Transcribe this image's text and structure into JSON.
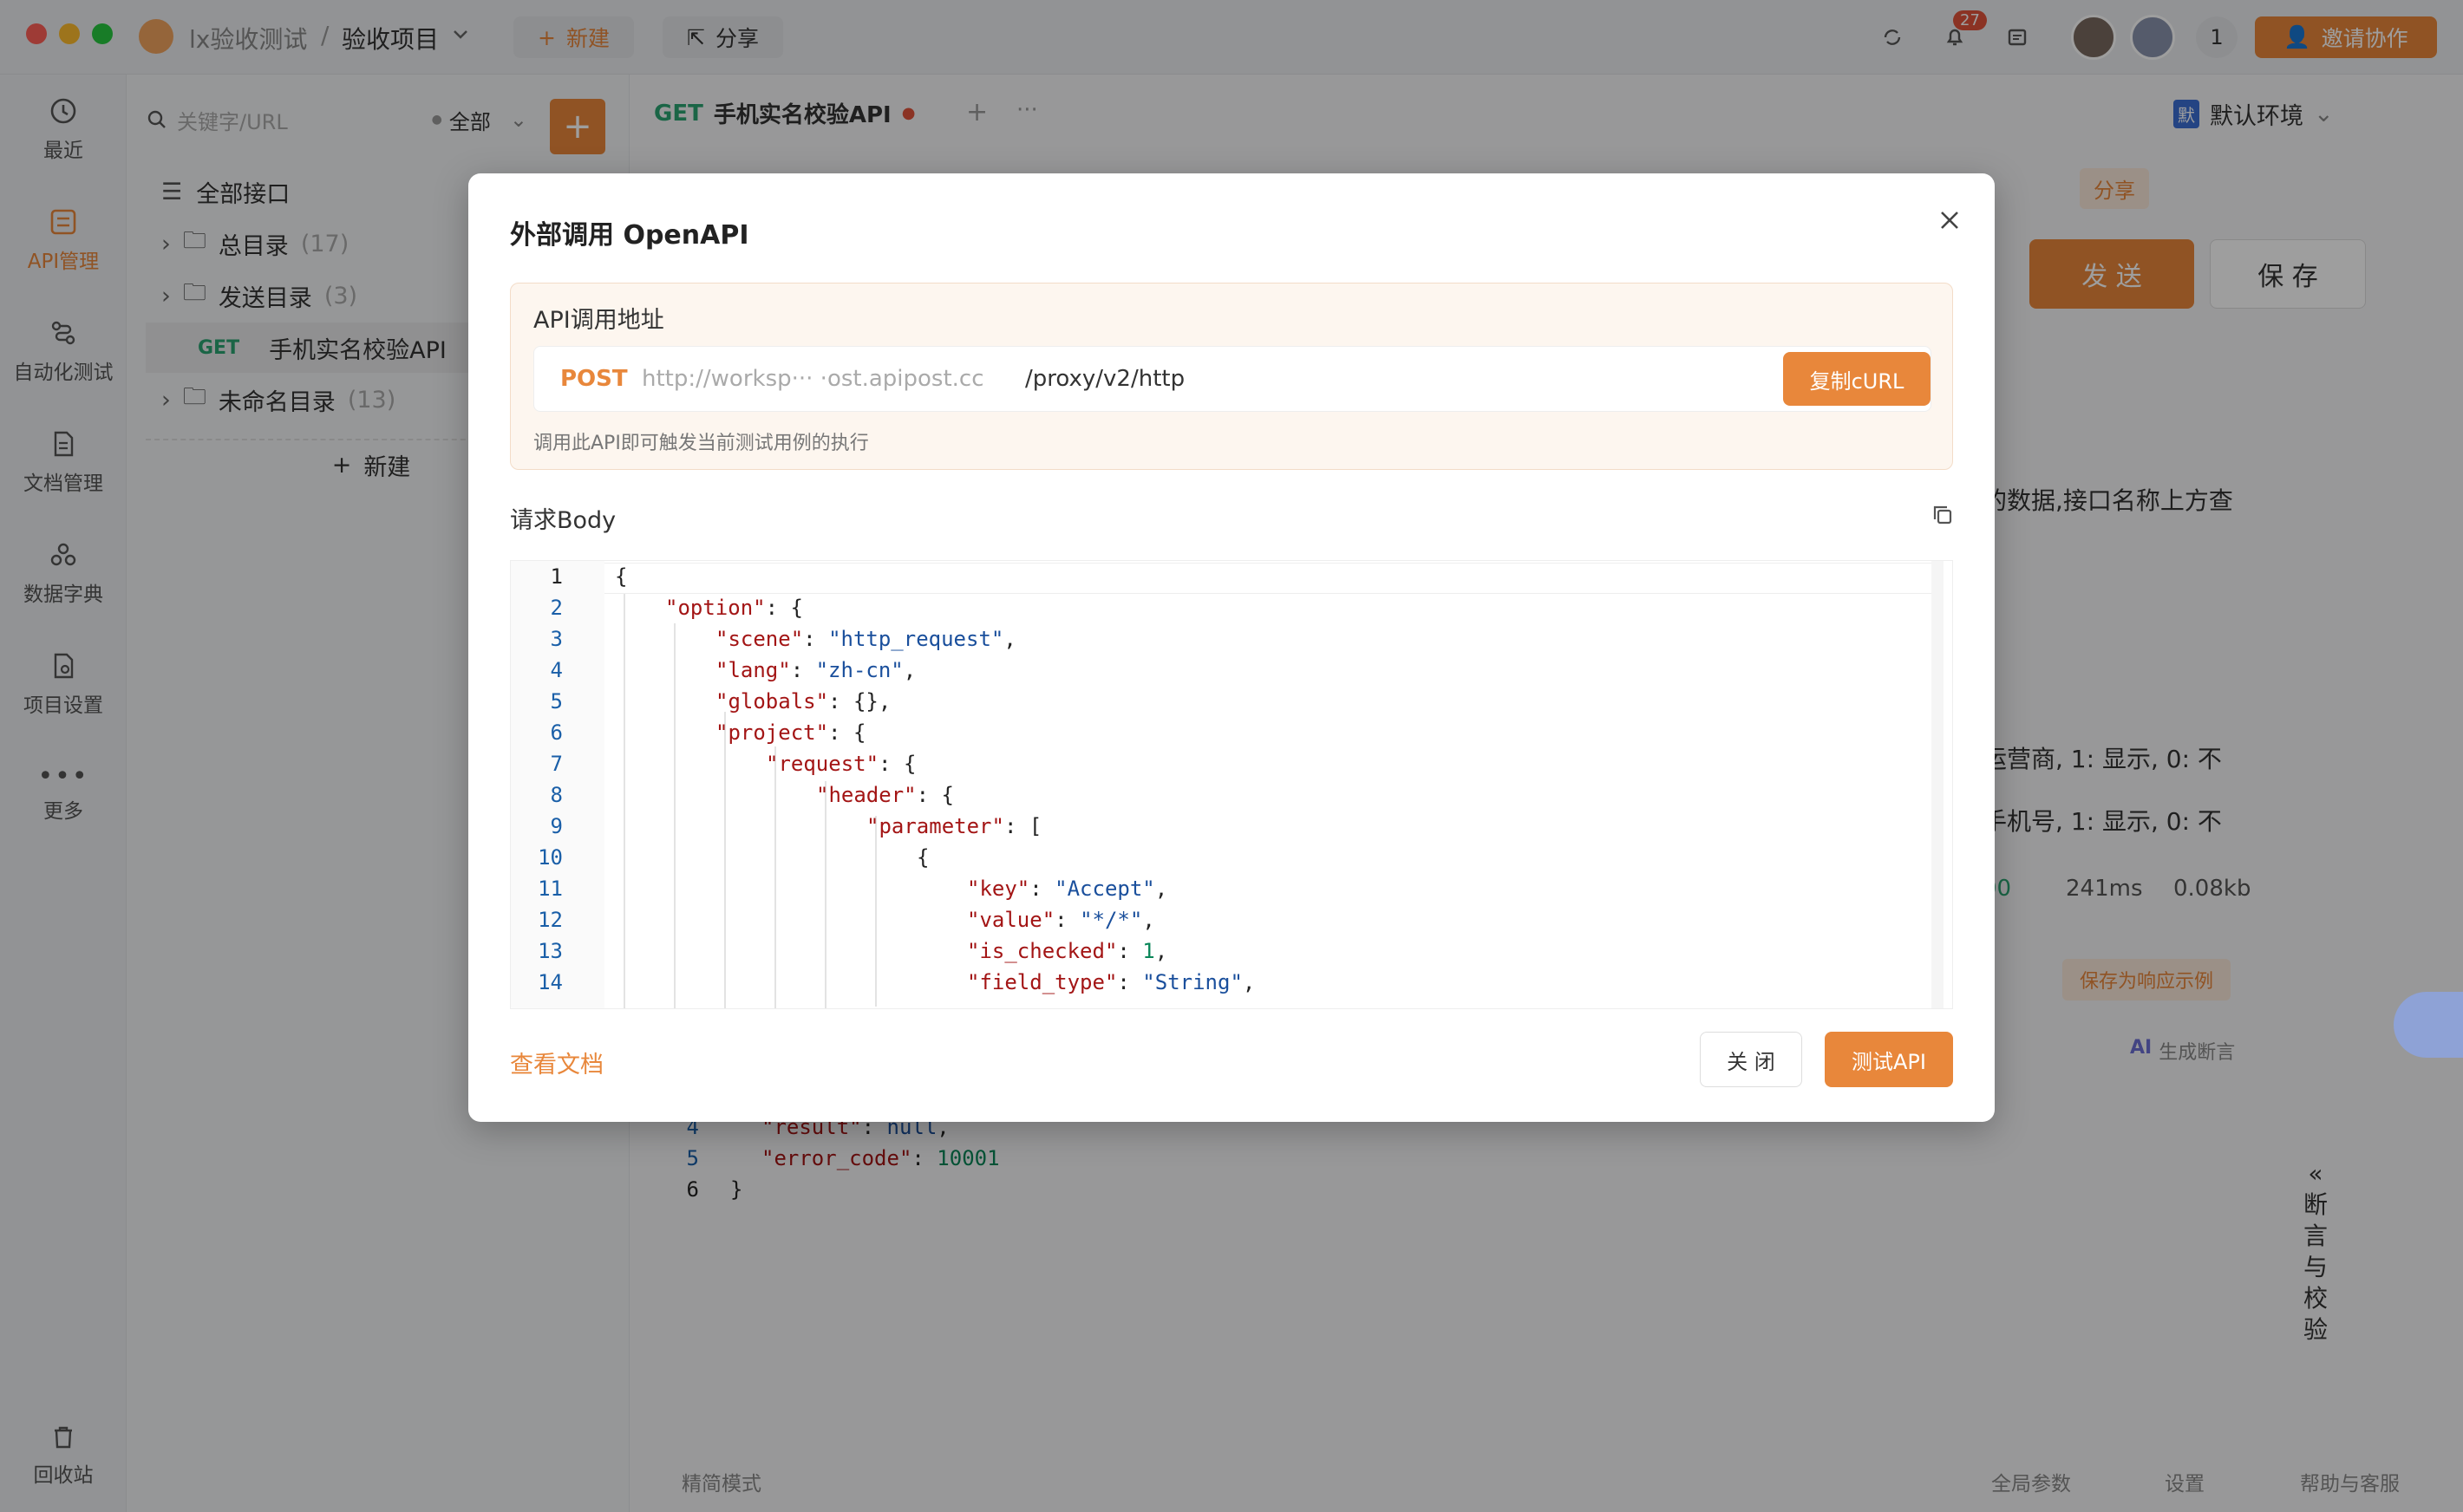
{
  "window": {
    "workspace": "lx验收测试",
    "separator": "/",
    "project": "验收项目",
    "new_label": "新建",
    "share_label": "分享",
    "notif_count": "27",
    "online_count": "1",
    "invite_label": "邀请协作"
  },
  "rail": {
    "items": [
      {
        "label": "最近",
        "icon": "clock-icon"
      },
      {
        "label": "API管理",
        "icon": "api-icon"
      },
      {
        "label": "自动化测试",
        "icon": "flow-icon"
      },
      {
        "label": "文档管理",
        "icon": "doc-icon"
      },
      {
        "label": "数据字典",
        "icon": "dict-icon"
      },
      {
        "label": "项目设置",
        "icon": "settings-icon"
      },
      {
        "label": "更多",
        "icon": "more-icon"
      }
    ],
    "recycle": "回收站"
  },
  "tree": {
    "search_placeholder": "关键字/URL",
    "filter": "全部",
    "all_label": "全部接口",
    "items": [
      {
        "name": "总目录",
        "count": "(17)"
      },
      {
        "name": "发送目录",
        "count": "(3)"
      },
      {
        "method": "GET",
        "name": "手机实名校验API"
      },
      {
        "name": "未命名目录",
        "count": "(13)"
      }
    ],
    "new_label": "新建"
  },
  "main": {
    "tab_method": "GET",
    "tab_title": "手机实名校验API",
    "env_badge": "默",
    "env": "默认环境",
    "share_label": "分享",
    "send_label": "发 送",
    "save_label": "保 存",
    "desc_partial": "的数据,接口名称上方查",
    "row1_partial": "运营商, 1: 显示, 0: 不",
    "row2_partial": "手机号, 1: 显示, 0: 不",
    "status_time": "241ms",
    "status_size": "0.08kb",
    "status_code_partial": "00",
    "save_example": "保存为响应示例",
    "ai_label": "生成断言",
    "side_panel_label": "断言与校验",
    "response_lines": [
      {
        "n": "4",
        "key": "\"result\"",
        "val": "null",
        "sep": ": ",
        "end": ","
      },
      {
        "n": "5",
        "key": "\"error_code\"",
        "val": "10001",
        "sep": ": ",
        "end": ""
      },
      {
        "n": "6",
        "text": "}"
      }
    ],
    "footer": {
      "simple": "精简模式",
      "global": "全局参数",
      "settings": "设置",
      "help": "帮助与客服"
    }
  },
  "modal": {
    "title": "外部调用 OpenAPI",
    "section_title": "API调用地址",
    "method": "POST",
    "url_host": "http://worksp··· ·ost.apipost.cc",
    "url_path": "/proxy/v2/http",
    "copy_curl": "复制cURL",
    "hint": "调用此API即可触发当前测试用例的执行",
    "body_title": "请求Body",
    "view_docs": "查看文档",
    "close_label": "关 闭",
    "test_label": "测试API"
  }
}
